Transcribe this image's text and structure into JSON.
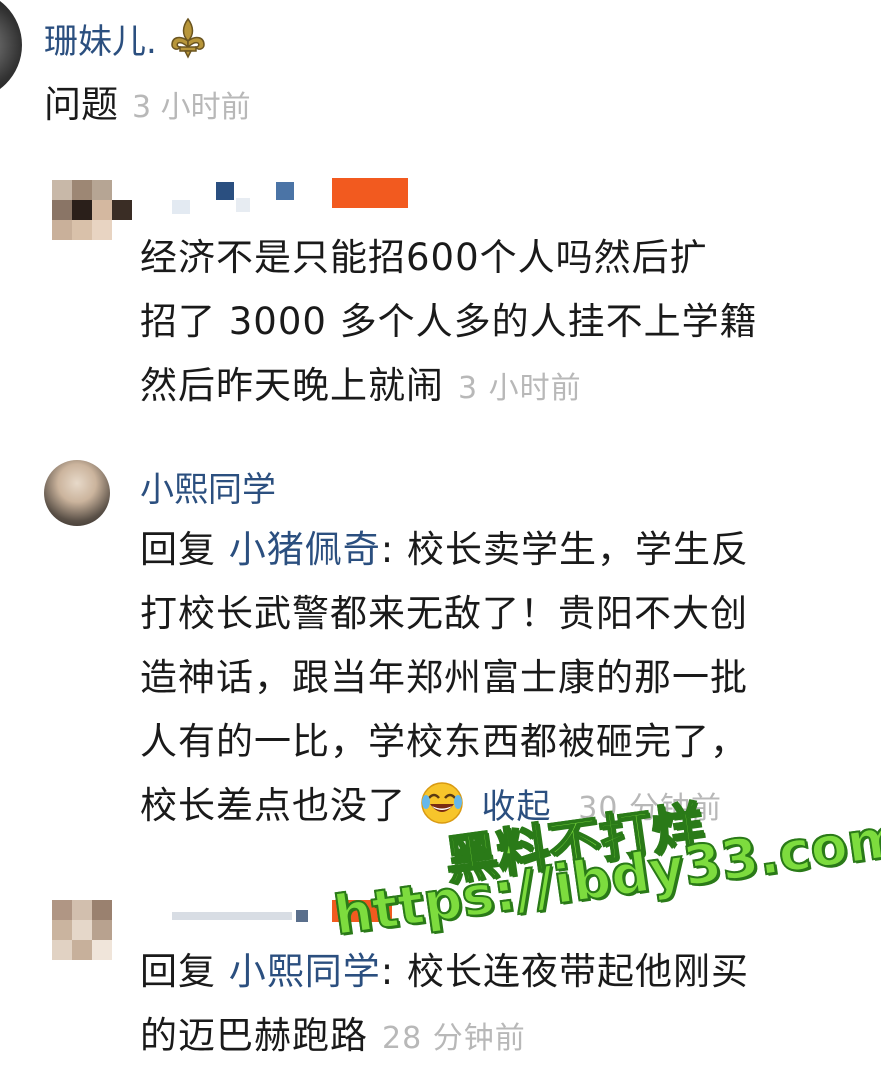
{
  "comment1": {
    "user": "珊妹儿.",
    "text": "问题",
    "time": "3 小时前"
  },
  "reply1": {
    "text_line1": "经济不是只能招600个人吗然后扩",
    "text_line2": "招了 3000 多个人多的人挂不上学籍",
    "text_line3": "然后昨天晚上就闹",
    "time": "3 小时前"
  },
  "comment2": {
    "user": "小熙同学",
    "reply_prefix": "回复",
    "reply_to": "小猪佩奇",
    "line1": ": 校长卖学生，学生反",
    "line2": "打校长武警都来无敌了！贵阳不大创",
    "line3": "造神话，跟当年郑州富士康的那一批",
    "line4": "人有的一比，学校东西都被砸完了，",
    "line5": "校长差点也没了",
    "collapse": "收起",
    "time": "30 分钟前"
  },
  "reply2": {
    "reply_prefix": "回复",
    "reply_to": "小熙同学",
    "line1": ": 校长连夜带起他刚买",
    "line2": "的迈巴赫跑路",
    "time": "28 分钟前"
  },
  "watermark": {
    "line1": "黑料不打烊",
    "line2": "https://ibdy33.com"
  },
  "icons": {
    "fleur": "fleur-de-lis-icon",
    "emoji": "crying-laughing-emoji-icon"
  },
  "colors": {
    "name": "#2b4f7f",
    "time": "#b8b8b8",
    "watermark": "#7ddc3e"
  }
}
